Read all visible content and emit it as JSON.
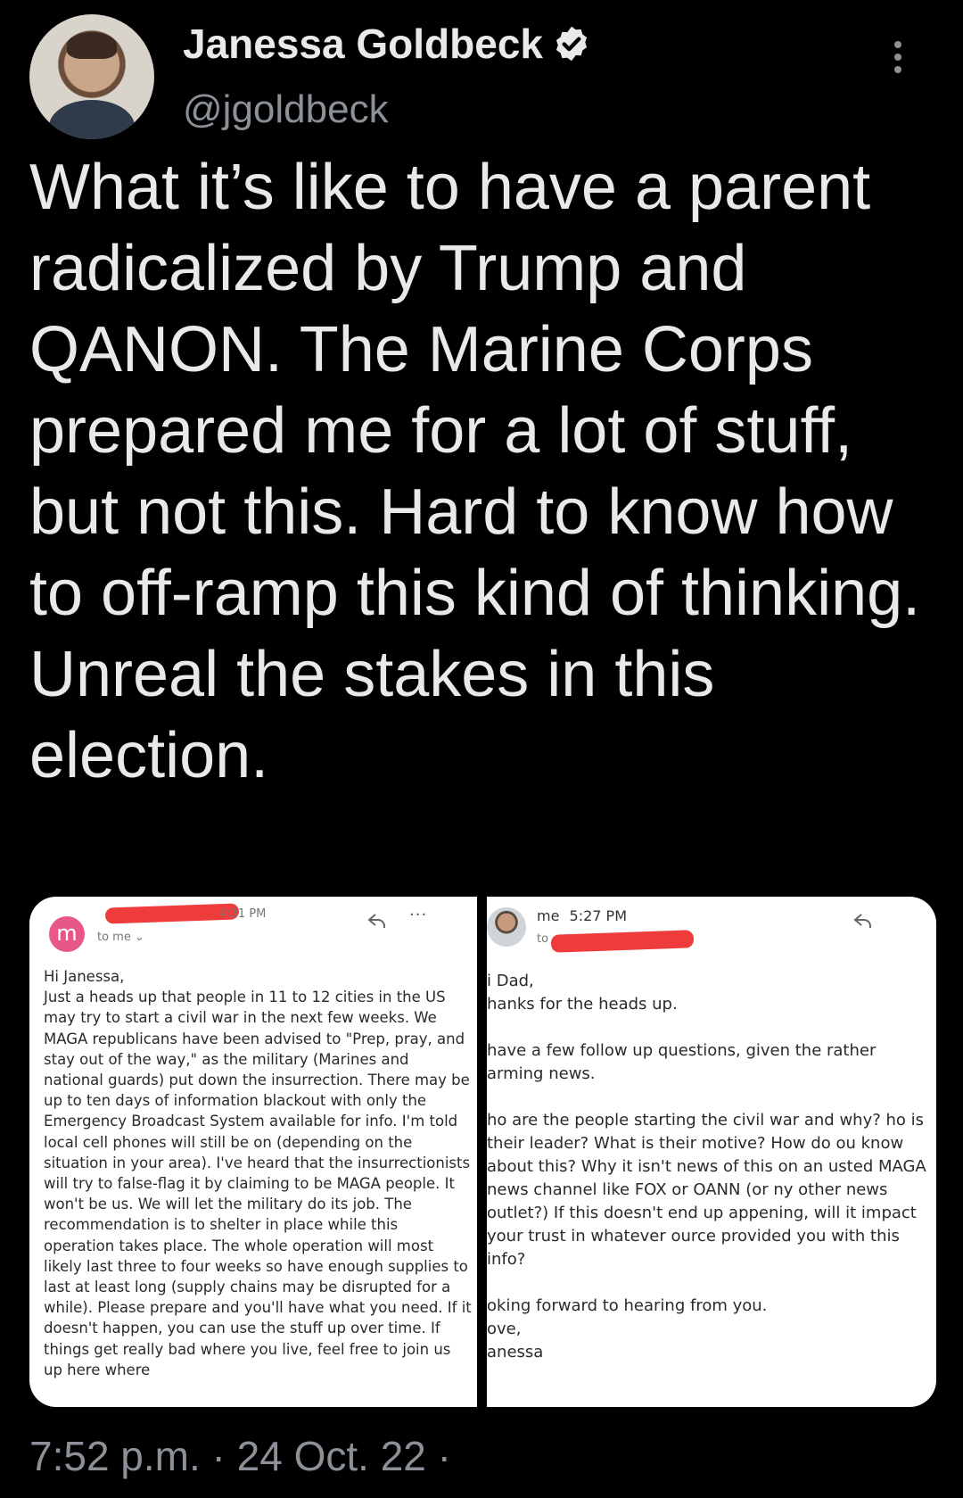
{
  "author": {
    "name": "Janessa Goldbeck",
    "handle": "@jgoldbeck",
    "avatar_icon": "profile-photo",
    "verified_icon": "verified-badge-icon"
  },
  "tweet": {
    "text": "What it’s like to have a parent radicalized by Trump and QANON. The Marine Corps prepared me for a lot of stuff, but not this. Hard to know how to off-ramp this kind of thinking. Unreal the stakes in this election.",
    "timestamp": "7:52 p.m. · 24 Oct. 22 ·"
  },
  "media": {
    "left_email": {
      "avatar_letter": "m",
      "time": "4:31 PM",
      "to": "to me ⌄",
      "body": "Hi Janessa,\nJust a heads up that people in 11 to 12 cities in the US may try to start a civil war in the next few weeks. We MAGA republicans have been advised to \"Prep, pray, and stay out of the way,\" as the military (Marines and national guards) put down the insurrection.  There may be up to ten days of information blackout with only the Emergency Broadcast System available for info.  I'm told local cell phones will still be on (depending on the situation in your area).  I've heard that the insurrectionists will try to false-flag it by claiming to be MAGA people.  It won't be us.  We will let the military do its job. The recommendation is to shelter in place while this operation takes place. The whole operation will most likely last three to four weeks so have enough supplies to last at least long (supply chains may be disrupted for a while). Please prepare and you'll have what you need.  If it doesn't happen, you can use the stuff up over time. If things get really bad where you live, feel free to join us up here where"
    },
    "right_email": {
      "sender": "me",
      "time": "5:27 PM",
      "to": "to",
      "body": "i Dad,\nhanks for the heads up.\n\nhave a few follow up questions, given the rather arming news.\n\nho are the people starting the civil war and why? ho is their leader? What is their motive? How do ou know about this? Why it isn't news of this on an usted MAGA news channel like FOX or OANN (or ny other news outlet?) If this doesn't end up appening, will it impact your trust in whatever ource provided you with this info?\n\noking forward to hearing from you.\nove,\nanessa"
    }
  },
  "colors": {
    "background": "#000000",
    "text": "#e7e9ea",
    "secondary": "#8b9197",
    "redaction": "#ee3b3b"
  }
}
